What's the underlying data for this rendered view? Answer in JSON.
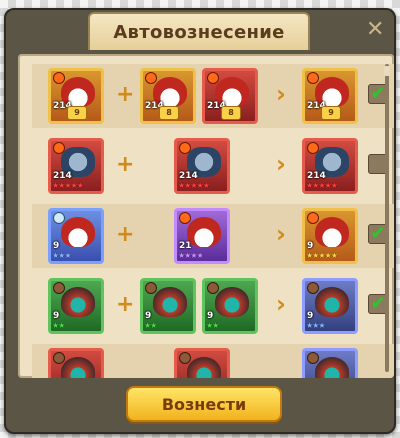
{
  "dialog": {
    "title": "Автовознесение",
    "close_glyph": "✕",
    "ascend_button": "Вознести"
  },
  "rows": [
    {
      "checked": true,
      "source": {
        "element": "fire",
        "level": "214",
        "stars": "",
        "badge": "9",
        "frame": "orange",
        "hero": "fox"
      },
      "materials": [
        {
          "element": "fire",
          "level": "214",
          "stars": "",
          "badge": "8",
          "frame": "orange",
          "hero": "fox"
        },
        {
          "element": "fire",
          "level": "214",
          "stars": "",
          "badge": "8",
          "frame": "red",
          "hero": "fox"
        }
      ],
      "result": {
        "element": "fire",
        "level": "214",
        "stars": "",
        "badge": "9",
        "frame": "orange",
        "hero": "fox"
      }
    },
    {
      "checked": false,
      "source": {
        "element": "fire",
        "level": "214",
        "stars": "★★★★★",
        "badge": "",
        "frame": "red",
        "hero": "knight"
      },
      "materials": [
        {
          "element": "fire",
          "level": "214",
          "stars": "★★★★★",
          "badge": "",
          "frame": "red",
          "hero": "knight"
        }
      ],
      "result": {
        "element": "fire",
        "level": "214",
        "stars": "★★★★★",
        "badge": "",
        "frame": "red",
        "hero": "knight"
      }
    },
    {
      "checked": true,
      "source": {
        "element": "ice",
        "level": "9",
        "stars": "★★★",
        "badge": "",
        "frame": "blue",
        "hero": "fox"
      },
      "materials": [
        {
          "element": "fire",
          "level": "21",
          "stars": "★★★★",
          "badge": "",
          "frame": "purple",
          "hero": "fox"
        }
      ],
      "result": {
        "element": "fire",
        "level": "9",
        "stars": "★★★★★",
        "badge": "",
        "frame": "orange",
        "hero": "fox"
      }
    },
    {
      "checked": true,
      "source": {
        "element": "earth",
        "level": "9",
        "stars": "★★",
        "badge": "",
        "frame": "green",
        "hero": "hood"
      },
      "materials": [
        {
          "element": "earth",
          "level": "9",
          "stars": "★★",
          "badge": "",
          "frame": "green",
          "hero": "hood"
        },
        {
          "element": "earth",
          "level": "9",
          "stars": "★★",
          "badge": "",
          "frame": "green",
          "hero": "hood"
        }
      ],
      "result": {
        "element": "earth",
        "level": "9",
        "stars": "★★★",
        "badge": "",
        "frame": "bluestar",
        "hero": "hood"
      }
    }
  ],
  "check_glyph": "✔",
  "plus_glyph": "+",
  "arrow_glyph": "›"
}
